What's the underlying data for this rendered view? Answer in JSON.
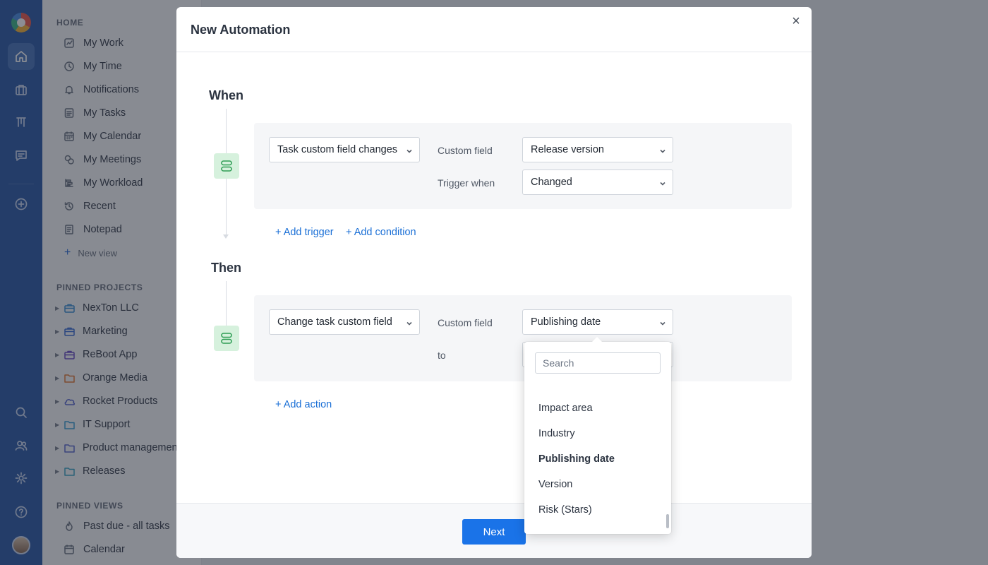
{
  "sidebar": {
    "home_label": "HOME",
    "nav": [
      {
        "label": "My Work",
        "icon": "chart-icon"
      },
      {
        "label": "My Time",
        "icon": "clock-icon"
      },
      {
        "label": "Notifications",
        "icon": "bell-icon"
      },
      {
        "label": "My Tasks",
        "icon": "tasks-icon"
      },
      {
        "label": "My Calendar",
        "icon": "calendar-icon"
      },
      {
        "label": "My Meetings",
        "icon": "meetings-icon"
      },
      {
        "label": "My Workload",
        "icon": "workload-icon"
      },
      {
        "label": "Recent",
        "icon": "history-icon"
      },
      {
        "label": "Notepad",
        "icon": "notepad-icon"
      }
    ],
    "new_view": "New view",
    "pinned_projects_label": "PINNED PROJECTS",
    "projects": [
      {
        "label": "NexTon LLC",
        "icon": "briefcase-icon",
        "color": "#3a8fd6"
      },
      {
        "label": "Marketing",
        "icon": "briefcase-icon",
        "color": "#3a6fd6"
      },
      {
        "label": "ReBoot App",
        "icon": "briefcase-icon",
        "color": "#6a4fc7"
      },
      {
        "label": "Orange Media",
        "icon": "folder-icon",
        "color": "#e07b39"
      },
      {
        "label": "Rocket Products",
        "icon": "cloud-icon",
        "color": "#5b6ad0"
      },
      {
        "label": "IT Support",
        "icon": "folder-icon",
        "color": "#3a9fd6"
      },
      {
        "label": "Product management",
        "icon": "folder-icon",
        "color": "#5b6ad0"
      },
      {
        "label": "Releases",
        "icon": "folder-icon",
        "color": "#3aa6c7"
      }
    ],
    "pinned_views_label": "PINNED VIEWS",
    "views": [
      {
        "label": "Past due - all tasks",
        "icon": "fire-icon"
      },
      {
        "label": "Calendar",
        "icon": "calendar-icon"
      }
    ]
  },
  "modal": {
    "title": "New Automation",
    "close": "×",
    "when": {
      "title": "When",
      "trigger": "Task custom field changes",
      "custom_field_label": "Custom field",
      "custom_field_value": "Release version",
      "trigger_when_label": "Trigger when",
      "trigger_when_value": "Changed",
      "add_trigger": "+ Add trigger",
      "add_condition": "+ Add condition"
    },
    "then": {
      "title": "Then",
      "action": "Change task custom field",
      "custom_field_label": "Custom field",
      "custom_field_value": "Publishing date",
      "to_label": "to",
      "add_action": "+ Add action"
    },
    "dropdown": {
      "search_placeholder": "Search",
      "items": [
        "Impact area",
        "Industry",
        "Publishing date",
        "Version",
        "Risk (Stars)"
      ],
      "selected": "Publishing date"
    },
    "next": "Next"
  },
  "colors": {
    "rail": "#2f5da8",
    "accent": "#1a73e8",
    "step_icon_bg": "#d6f1dd"
  }
}
